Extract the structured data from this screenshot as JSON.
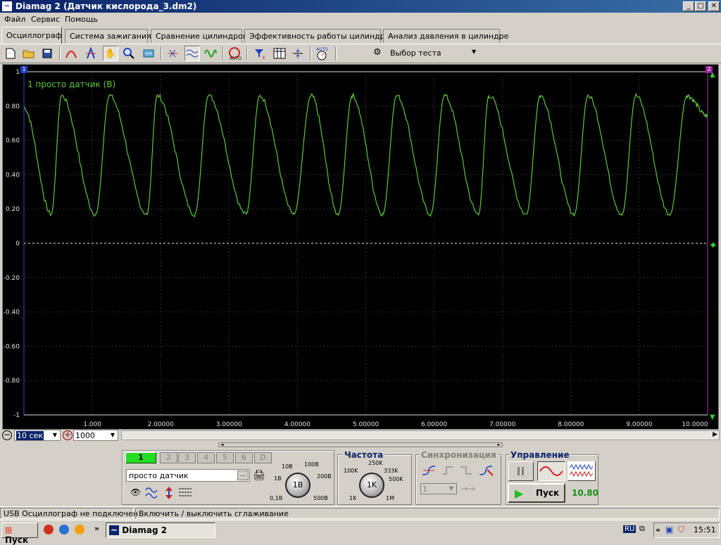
{
  "window": {
    "title": "Diamag 2 (Датчик кислорода_3.dm2)",
    "min": "_",
    "max": "□",
    "close": "✕"
  },
  "menu": [
    "Файл",
    "Сервис",
    "Помощь"
  ],
  "tabs": [
    "Осциллограф",
    "Система зажигания",
    "Сравнение цилиндров",
    "Эффективность работы цилиндров",
    "Анализ давления в цилиндре"
  ],
  "toolbar": {
    "test_select": "Выбор теста"
  },
  "scope": {
    "channel_label": "1 просто датчик (В)",
    "cursor_left": "1",
    "cursor_right": "2",
    "trace_color": "#5cc83a",
    "background": "#000000"
  },
  "chart_data": {
    "type": "line",
    "series": [
      {
        "name": "1 просто датчик (В)",
        "color": "#5cc83a"
      }
    ],
    "ylim": [
      -1,
      1
    ],
    "xlim": [
      0,
      10
    ],
    "ytick_labels": [
      "1",
      "0.80",
      "0.60",
      "0.40",
      "0.20",
      "0",
      "-0.20",
      "-0.40",
      "-0.60",
      "-0.80",
      "-1"
    ],
    "ytick_values": [
      1,
      0.8,
      0.6,
      0.4,
      0.2,
      0,
      -0.2,
      -0.4,
      -0.6,
      -0.8,
      -1
    ],
    "xtick_labels": [
      "1.000",
      "2.00000",
      "3.00000",
      "4.00000",
      "5.00000",
      "6.00000",
      "7.00000",
      "8.00000",
      "9.00000",
      "10.0000"
    ],
    "xtick_values": [
      1,
      2,
      3,
      4,
      5,
      6,
      7,
      8,
      9,
      10
    ],
    "peak_x": [
      0.55,
      1.25,
      1.95,
      2.7,
      3.45,
      4.2,
      4.8,
      5.45,
      6.15,
      6.8,
      7.55,
      8.25,
      8.95,
      9.7
    ],
    "trough_x": [
      0.4,
      1.05,
      1.8,
      2.5,
      3.25,
      3.95,
      4.6,
      5.25,
      5.95,
      6.65,
      7.35,
      8.05,
      8.75,
      9.45
    ],
    "peak_value": 0.86,
    "trough_value": 0.17,
    "grid": true,
    "zero_line": true
  },
  "zoom": {
    "time": "10 сек",
    "points": "1000"
  },
  "channels": [
    "1",
    "2",
    "3",
    "4",
    "5",
    "6",
    "D"
  ],
  "channel": {
    "name": "просто датчик",
    "dots": "...",
    "knob_value": "1В",
    "knob_labels": [
      "10В",
      "100В",
      "1В",
      "200В",
      "0,1В",
      "500В"
    ]
  },
  "freq": {
    "title": "Частота",
    "knob_value": "1K",
    "knob_labels": [
      "250K",
      "100K",
      "333K",
      "500K",
      "1K",
      "1M"
    ]
  },
  "sync": {
    "title": "Синхронизация",
    "value": "1"
  },
  "control": {
    "title": "Управление",
    "start": "Пуск",
    "readout": "10.80"
  },
  "status": {
    "left": "USB Осциллограф не подключен",
    "right": "Включить / выключить сглаживание"
  },
  "taskbar": {
    "start": "Пуск",
    "task": "Diamag 2",
    "lang": "RU",
    "time": "15:51",
    "more": "»",
    "tray_more": "«"
  }
}
